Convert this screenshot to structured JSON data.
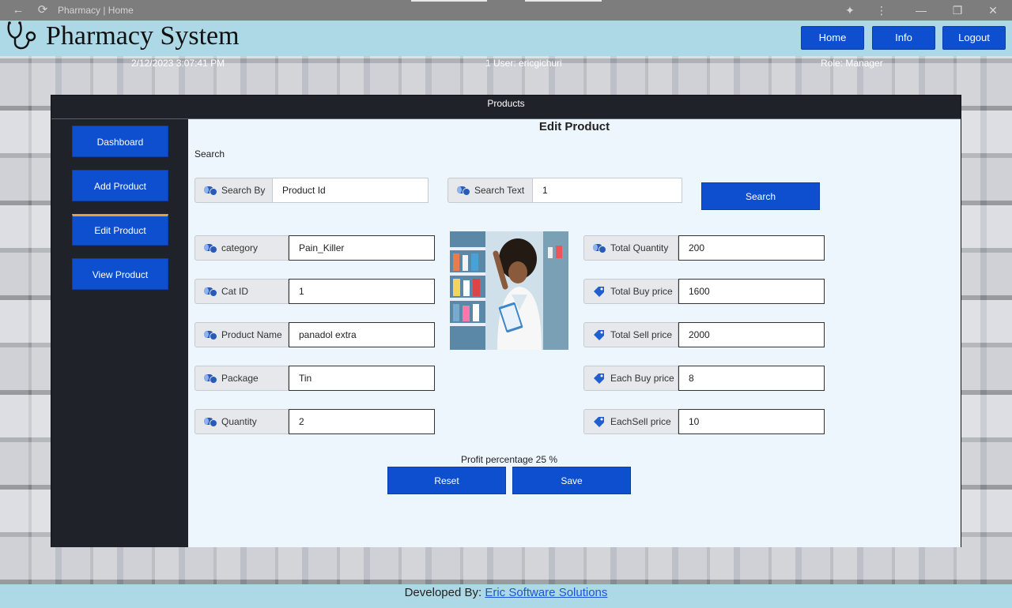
{
  "window": {
    "title": "Pharmacy | Home"
  },
  "header": {
    "app_title": "Pharmacy System",
    "nav": [
      "Home",
      "Info",
      "Logout"
    ]
  },
  "status": {
    "datetime": "2/12/2023 3:07:41 PM",
    "user": "1 User: ericgichuri",
    "role": "Role: Manager"
  },
  "panel": {
    "title": "Products",
    "heading": "Edit Product",
    "sidebar": [
      "Dashboard",
      "Add Product",
      "Edit Product",
      "View Product"
    ],
    "active_item": "Edit Product"
  },
  "search": {
    "section_label": "Search",
    "by_label": "Search By",
    "by_value": "Product Id",
    "text_label": "Search Text",
    "text_value": "1",
    "button": "Search"
  },
  "left_fields": [
    {
      "label": "category",
      "value": "Pain_Killer"
    },
    {
      "label": "Cat ID",
      "value": "1"
    },
    {
      "label": "Product Name",
      "value": "panadol extra"
    },
    {
      "label": "Package",
      "value": "Tin"
    },
    {
      "label": "Quantity",
      "value": "2"
    }
  ],
  "right_fields": [
    {
      "label": "Total Quantity",
      "value": "200"
    },
    {
      "label": "Total Buy price",
      "value": "1600"
    },
    {
      "label": "Total Sell price",
      "value": "2000"
    },
    {
      "label": "Each Buy price",
      "value": "8"
    },
    {
      "label": "EachSell price",
      "value": "10"
    }
  ],
  "profit_text": "Profit percentage 25 %",
  "actions": {
    "reset": "Reset",
    "save": "Save"
  },
  "footer": {
    "prefix": "Developed By: ",
    "link": "Eric Software Solutions"
  },
  "colors": {
    "accent": "#0d4fcf",
    "header_bg": "#add8e6",
    "panel_bg": "#1f2228",
    "content_bg": "#eef6fd",
    "active_marker": "#e5a13a"
  },
  "icons": {
    "field_left": "pill-capsule-icon",
    "field_right": "price-tag-icon",
    "logo": "stethoscope-icon"
  }
}
